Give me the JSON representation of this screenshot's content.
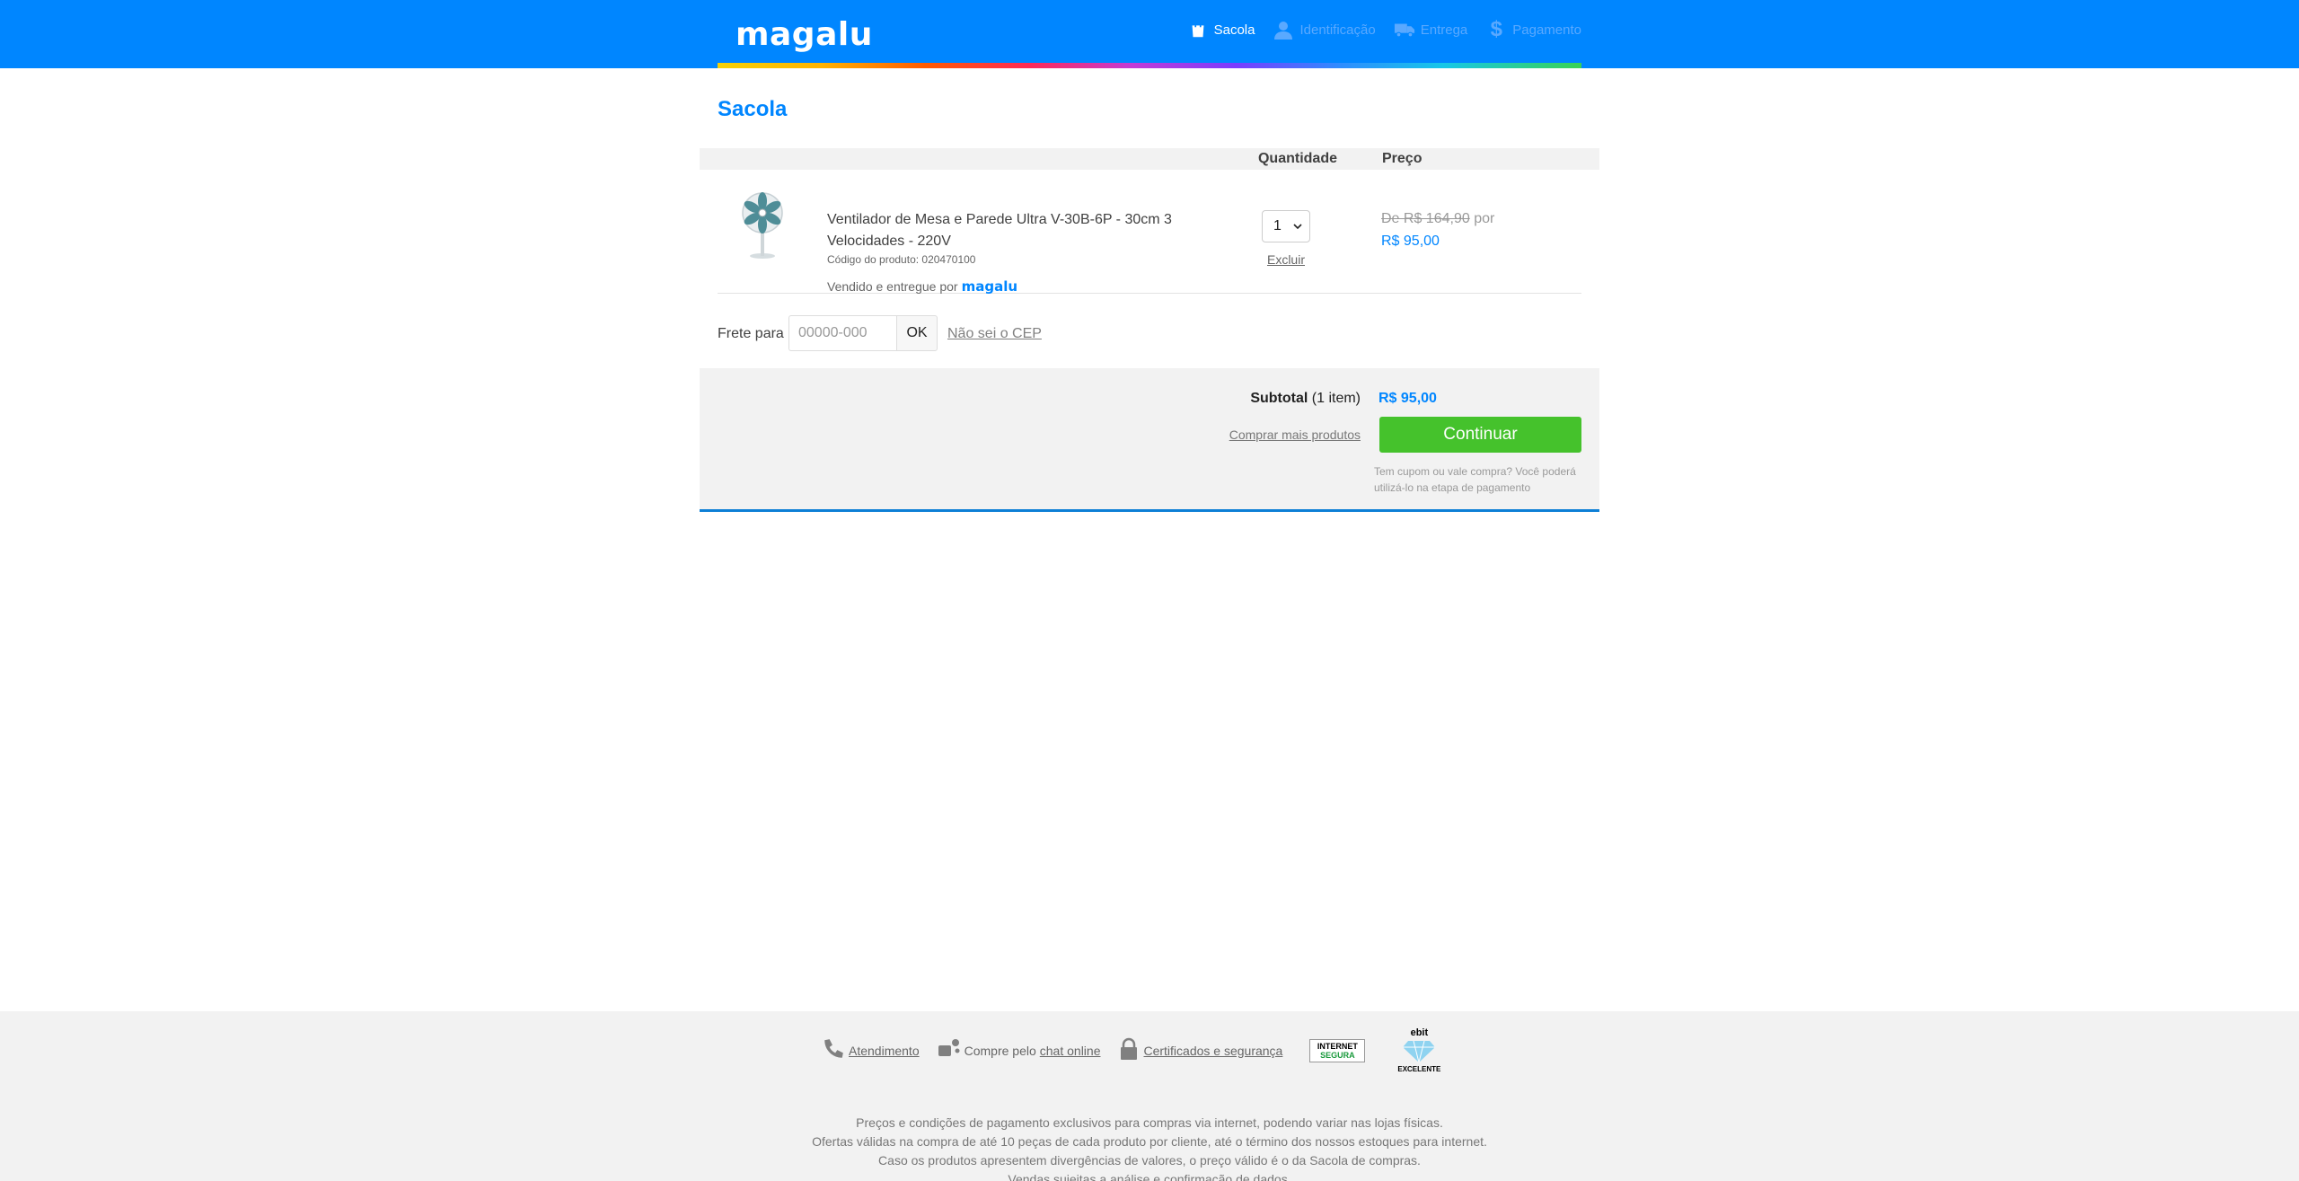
{
  "header": {
    "logo": "magalu",
    "steps": [
      {
        "label": "Sacola",
        "icon": "bag-icon",
        "active": true
      },
      {
        "label": "Identificação",
        "icon": "user-icon",
        "active": false
      },
      {
        "label": "Entrega",
        "icon": "truck-icon",
        "active": false
      },
      {
        "label": "Pagamento",
        "icon": "dollar-icon",
        "active": false
      }
    ]
  },
  "page_title": "Sacola",
  "cart": {
    "col_quantity": "Quantidade",
    "col_price": "Preço",
    "item": {
      "name": "Ventilador de Mesa e Parede Ultra V-30B-6P - 30cm 3 Velocidades - 220V",
      "code": "Código do produto: 020470100",
      "seller_text": "Vendido e entregue por",
      "seller_logo": "magalu",
      "quantity": "1",
      "remove": "Excluir",
      "price_old": "De R$ 164,90",
      "price_old_suffix": "por",
      "price_new": "R$ 95,00"
    }
  },
  "shipping": {
    "label": "Frete para",
    "placeholder": "00000-000",
    "ok": "OK",
    "dont_know": "Não sei o CEP"
  },
  "summary": {
    "subtotal_label": "Subtotal",
    "subtotal_items": "(1 item)",
    "subtotal_value": "R$ 95,00",
    "more_products": "Comprar mais produtos",
    "continue": "Continuar",
    "coupon_note": "Tem cupom ou vale compra? Você poderá utilizá-lo na etapa de pagamento"
  },
  "footer": {
    "links": {
      "support": "Atendimento",
      "chat_prefix": "Compre pelo",
      "chat": "chat online",
      "certificates": "Certificados e segurança"
    },
    "seal_internet_1": "INTERNET",
    "seal_internet_2": "SEGURA",
    "seal_ebit": "ebit",
    "seal_ebit_level": "EXCELENTE",
    "lines": [
      "Preços e condições de pagamento exclusivos para compras via internet, podendo variar nas lojas físicas.",
      "Ofertas válidas na compra de até 10 peças de cada produto por cliente, até o término dos nossos estoques para internet.",
      "Caso os produtos apresentem divergências de valores, o preço válido é o da Sacola de compras.",
      "Vendas sujeitas a análise e confirmação de dados."
    ]
  },
  "colors": {
    "brand_blue": "#0086ff",
    "continue_green": "#45c22c"
  }
}
